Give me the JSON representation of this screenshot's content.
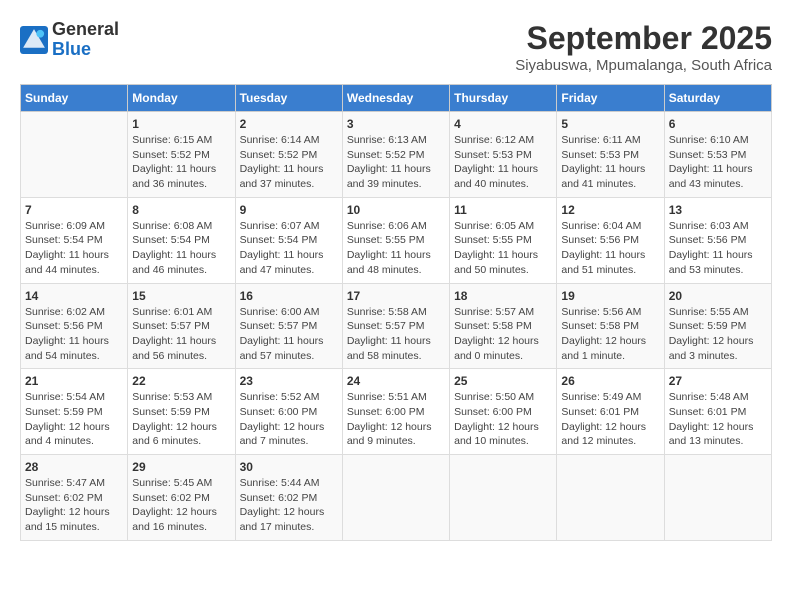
{
  "logo": {
    "general": "General",
    "blue": "Blue"
  },
  "title": "September 2025",
  "subtitle": "Siyabuswa, Mpumalanga, South Africa",
  "headers": [
    "Sunday",
    "Monday",
    "Tuesday",
    "Wednesday",
    "Thursday",
    "Friday",
    "Saturday"
  ],
  "weeks": [
    [
      {
        "day": "",
        "info": ""
      },
      {
        "day": "1",
        "info": "Sunrise: 6:15 AM\nSunset: 5:52 PM\nDaylight: 11 hours\nand 36 minutes."
      },
      {
        "day": "2",
        "info": "Sunrise: 6:14 AM\nSunset: 5:52 PM\nDaylight: 11 hours\nand 37 minutes."
      },
      {
        "day": "3",
        "info": "Sunrise: 6:13 AM\nSunset: 5:52 PM\nDaylight: 11 hours\nand 39 minutes."
      },
      {
        "day": "4",
        "info": "Sunrise: 6:12 AM\nSunset: 5:53 PM\nDaylight: 11 hours\nand 40 minutes."
      },
      {
        "day": "5",
        "info": "Sunrise: 6:11 AM\nSunset: 5:53 PM\nDaylight: 11 hours\nand 41 minutes."
      },
      {
        "day": "6",
        "info": "Sunrise: 6:10 AM\nSunset: 5:53 PM\nDaylight: 11 hours\nand 43 minutes."
      }
    ],
    [
      {
        "day": "7",
        "info": "Sunrise: 6:09 AM\nSunset: 5:54 PM\nDaylight: 11 hours\nand 44 minutes."
      },
      {
        "day": "8",
        "info": "Sunrise: 6:08 AM\nSunset: 5:54 PM\nDaylight: 11 hours\nand 46 minutes."
      },
      {
        "day": "9",
        "info": "Sunrise: 6:07 AM\nSunset: 5:54 PM\nDaylight: 11 hours\nand 47 minutes."
      },
      {
        "day": "10",
        "info": "Sunrise: 6:06 AM\nSunset: 5:55 PM\nDaylight: 11 hours\nand 48 minutes."
      },
      {
        "day": "11",
        "info": "Sunrise: 6:05 AM\nSunset: 5:55 PM\nDaylight: 11 hours\nand 50 minutes."
      },
      {
        "day": "12",
        "info": "Sunrise: 6:04 AM\nSunset: 5:56 PM\nDaylight: 11 hours\nand 51 minutes."
      },
      {
        "day": "13",
        "info": "Sunrise: 6:03 AM\nSunset: 5:56 PM\nDaylight: 11 hours\nand 53 minutes."
      }
    ],
    [
      {
        "day": "14",
        "info": "Sunrise: 6:02 AM\nSunset: 5:56 PM\nDaylight: 11 hours\nand 54 minutes."
      },
      {
        "day": "15",
        "info": "Sunrise: 6:01 AM\nSunset: 5:57 PM\nDaylight: 11 hours\nand 56 minutes."
      },
      {
        "day": "16",
        "info": "Sunrise: 6:00 AM\nSunset: 5:57 PM\nDaylight: 11 hours\nand 57 minutes."
      },
      {
        "day": "17",
        "info": "Sunrise: 5:58 AM\nSunset: 5:57 PM\nDaylight: 11 hours\nand 58 minutes."
      },
      {
        "day": "18",
        "info": "Sunrise: 5:57 AM\nSunset: 5:58 PM\nDaylight: 12 hours\nand 0 minutes."
      },
      {
        "day": "19",
        "info": "Sunrise: 5:56 AM\nSunset: 5:58 PM\nDaylight: 12 hours\nand 1 minute."
      },
      {
        "day": "20",
        "info": "Sunrise: 5:55 AM\nSunset: 5:59 PM\nDaylight: 12 hours\nand 3 minutes."
      }
    ],
    [
      {
        "day": "21",
        "info": "Sunrise: 5:54 AM\nSunset: 5:59 PM\nDaylight: 12 hours\nand 4 minutes."
      },
      {
        "day": "22",
        "info": "Sunrise: 5:53 AM\nSunset: 5:59 PM\nDaylight: 12 hours\nand 6 minutes."
      },
      {
        "day": "23",
        "info": "Sunrise: 5:52 AM\nSunset: 6:00 PM\nDaylight: 12 hours\nand 7 minutes."
      },
      {
        "day": "24",
        "info": "Sunrise: 5:51 AM\nSunset: 6:00 PM\nDaylight: 12 hours\nand 9 minutes."
      },
      {
        "day": "25",
        "info": "Sunrise: 5:50 AM\nSunset: 6:00 PM\nDaylight: 12 hours\nand 10 minutes."
      },
      {
        "day": "26",
        "info": "Sunrise: 5:49 AM\nSunset: 6:01 PM\nDaylight: 12 hours\nand 12 minutes."
      },
      {
        "day": "27",
        "info": "Sunrise: 5:48 AM\nSunset: 6:01 PM\nDaylight: 12 hours\nand 13 minutes."
      }
    ],
    [
      {
        "day": "28",
        "info": "Sunrise: 5:47 AM\nSunset: 6:02 PM\nDaylight: 12 hours\nand 15 minutes."
      },
      {
        "day": "29",
        "info": "Sunrise: 5:45 AM\nSunset: 6:02 PM\nDaylight: 12 hours\nand 16 minutes."
      },
      {
        "day": "30",
        "info": "Sunrise: 5:44 AM\nSunset: 6:02 PM\nDaylight: 12 hours\nand 17 minutes."
      },
      {
        "day": "",
        "info": ""
      },
      {
        "day": "",
        "info": ""
      },
      {
        "day": "",
        "info": ""
      },
      {
        "day": "",
        "info": ""
      }
    ]
  ]
}
